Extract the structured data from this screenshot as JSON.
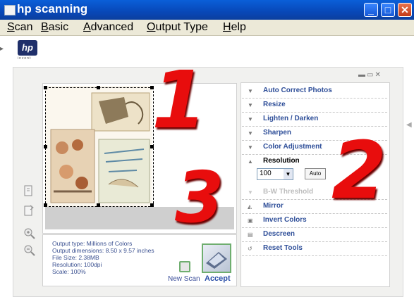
{
  "window": {
    "title": "hp scanning",
    "minimize": "_",
    "maximize": "□",
    "close": "✕"
  },
  "menu": [
    "Scan",
    "Basic",
    "Advanced",
    "Output Type",
    "Help"
  ],
  "logo": {
    "mark": "hp",
    "tagline": "invent"
  },
  "info": {
    "lines": [
      "Output type: Millions of Colors",
      "Output dimensions: 8.50 x 9.57 inches",
      "File Size: 2.38MB",
      "Resolution: 100dpi",
      "Scale: 100%"
    ],
    "new_scan": "New Scan",
    "accept": "Accept"
  },
  "tools_panel": {
    "items": [
      {
        "label": "Auto Correct Photos",
        "icon": "triangle-down-icon"
      },
      {
        "label": "Resize",
        "icon": "triangle-down-icon"
      },
      {
        "label": "Lighten / Darken",
        "icon": "triangle-down-icon"
      },
      {
        "label": "Sharpen",
        "icon": "triangle-down-icon"
      },
      {
        "label": "Color Adjustment",
        "icon": "triangle-down-icon"
      },
      {
        "label": "Resolution",
        "icon": "triangle-up-icon"
      },
      {
        "label": "B-W Threshold",
        "icon": "triangle-down-icon",
        "disabled": true
      },
      {
        "label": "Mirror",
        "icon": "mirror-icon"
      },
      {
        "label": "Invert Colors",
        "icon": "invert-icon"
      },
      {
        "label": "Descreen",
        "icon": "descreen-icon"
      },
      {
        "label": "Reset Tools",
        "icon": "reset-icon"
      }
    ],
    "resolution_value": "100",
    "auto_label": "Auto"
  },
  "annotations": [
    "1",
    "2",
    "3"
  ],
  "colors": {
    "title_bar": "#0a5fd8",
    "annotation_red": "#e80d0d",
    "tool_label": "#2f4f99",
    "accent_green": "#6fae6f"
  }
}
